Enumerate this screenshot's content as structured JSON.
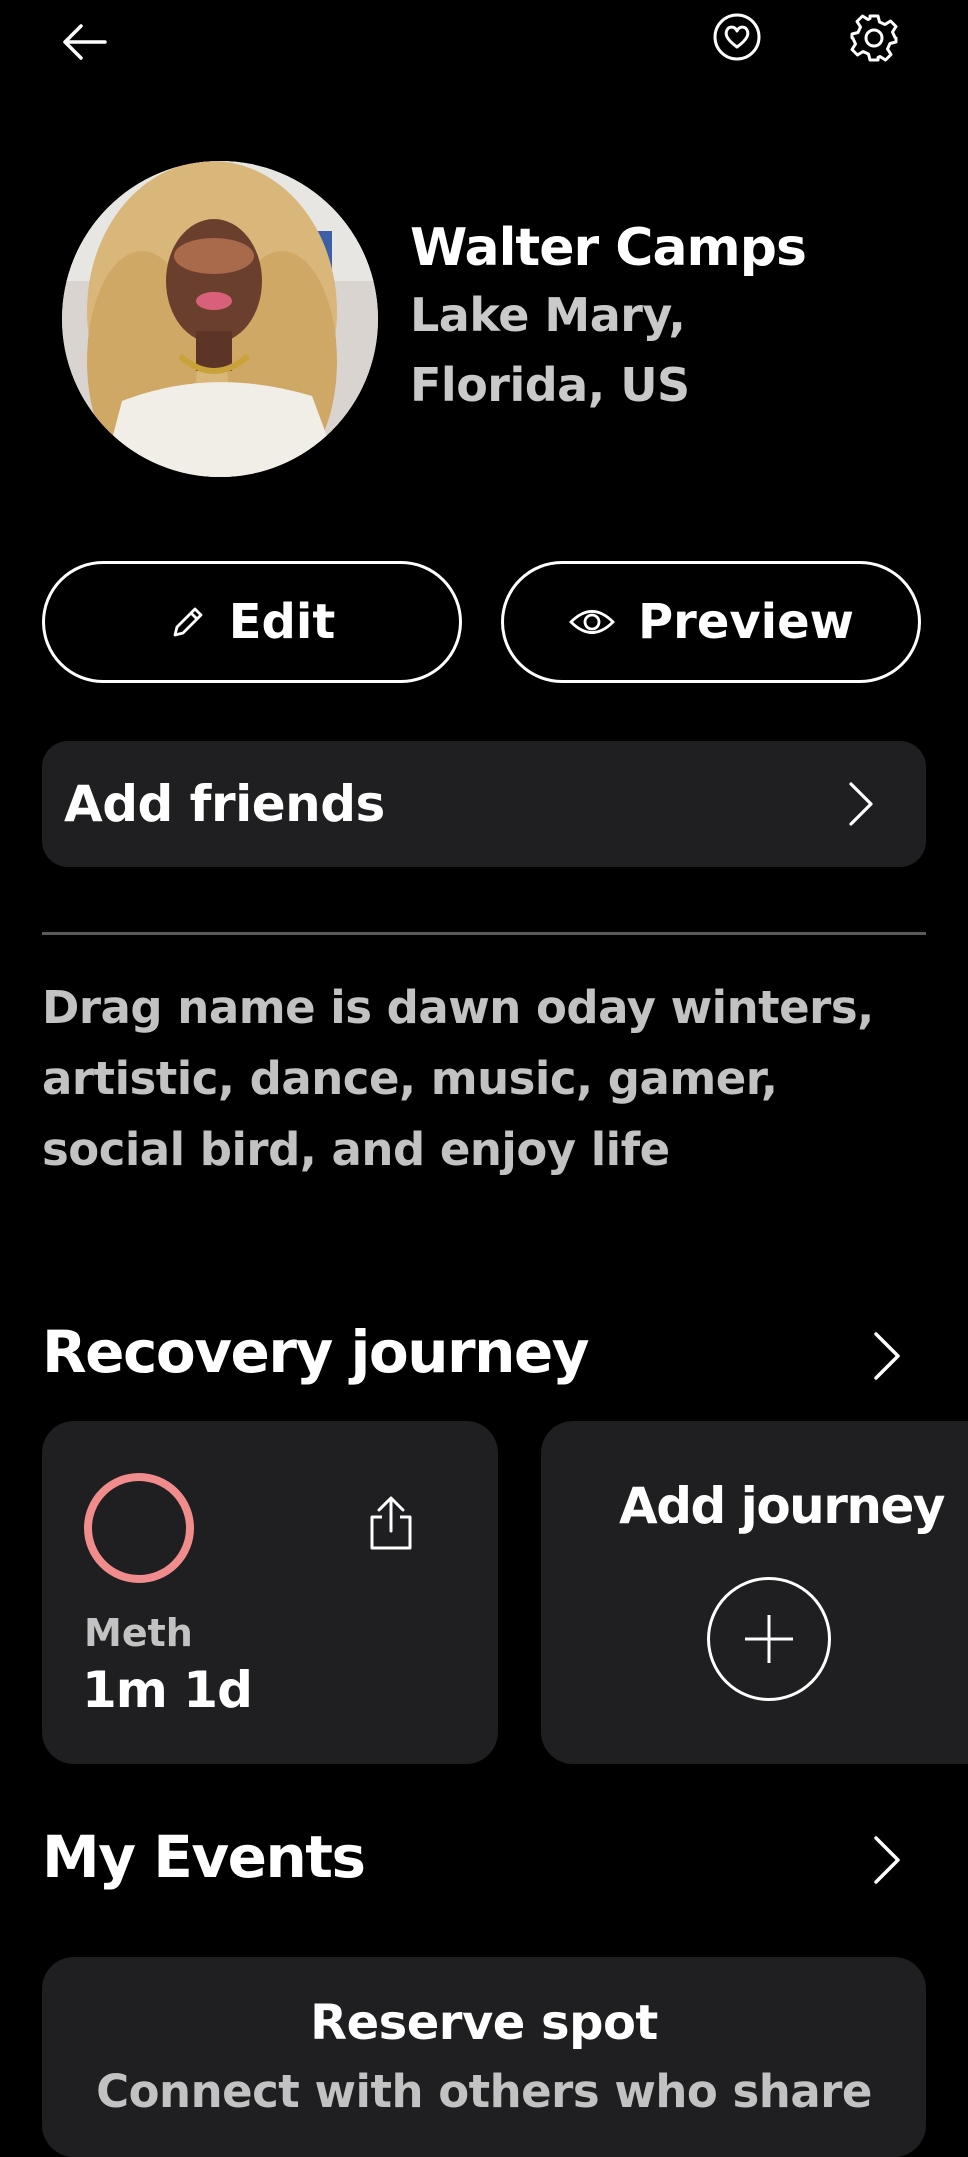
{
  "header": {
    "back_icon": "arrow-left-icon",
    "favorites_icon": "heart-circle-icon",
    "settings_icon": "gear-icon"
  },
  "profile": {
    "name": "Walter Camps",
    "location": "Lake Mary, Florida, US",
    "avatar_icon": "profile-photo"
  },
  "actions": {
    "edit_label": "Edit",
    "preview_label": "Preview"
  },
  "friends": {
    "label": "Add friends"
  },
  "bio": {
    "text": "Drag name is dawn oday winters, artistic, dance, music, gamer, social bird, and enjoy life"
  },
  "recovery": {
    "title": "Recovery journey",
    "journeys": [
      {
        "substance": "Meth",
        "duration": "1m 1d"
      }
    ],
    "add_label": "Add journey"
  },
  "events": {
    "title": "My Events",
    "card_title": "Reserve spot",
    "card_subtitle": "Connect with others who share"
  },
  "colors": {
    "background": "#000000",
    "card": "#1f1e20",
    "accent_ring": "#f08c8c",
    "muted_text": "#c2c2c2"
  }
}
